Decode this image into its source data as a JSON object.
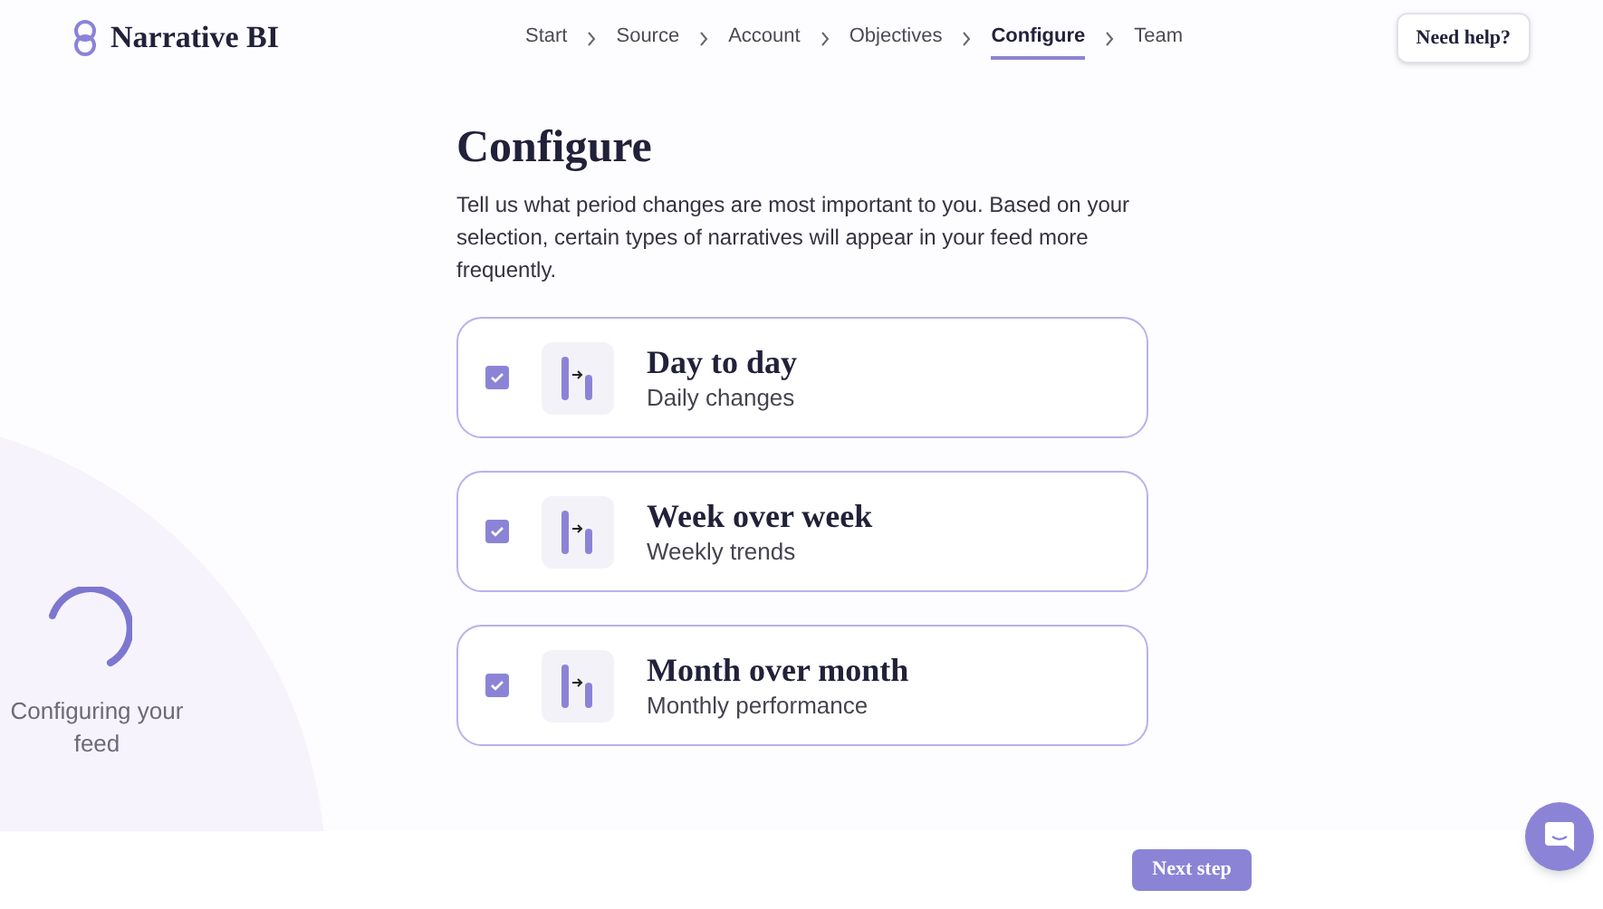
{
  "brand": "Narrative BI",
  "steps": [
    {
      "label": "Start",
      "selected": false
    },
    {
      "label": "Source",
      "selected": false
    },
    {
      "label": "Account",
      "selected": false
    },
    {
      "label": "Objectives",
      "selected": false
    },
    {
      "label": "Configure",
      "selected": true
    },
    {
      "label": "Team",
      "selected": false
    }
  ],
  "help_button": "Need help?",
  "title": "Configure",
  "description": "Tell us what period changes are most important to you. Based on your selection, certain types of narratives will appear in your feed more frequently.",
  "options": [
    {
      "title": "Day to day",
      "subtitle": "Daily changes",
      "checked": true
    },
    {
      "title": "Week over week",
      "subtitle": "Weekly trends",
      "checked": true
    },
    {
      "title": "Month over month",
      "subtitle": "Monthly performance",
      "checked": true
    }
  ],
  "loading": {
    "label": "Configuring your feed"
  },
  "next_button": "Next step"
}
